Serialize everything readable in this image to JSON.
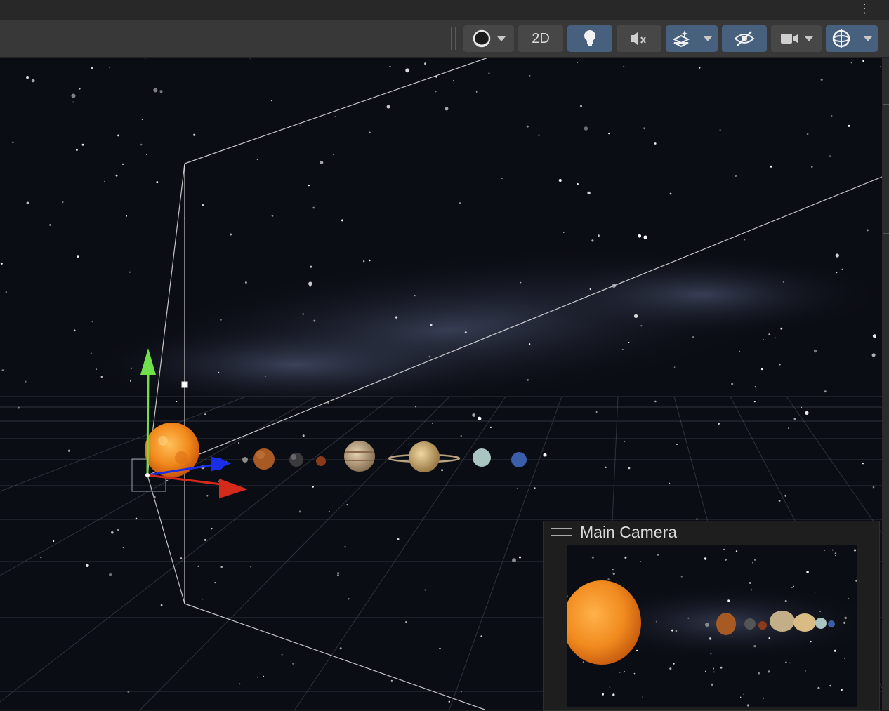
{
  "toolbar": {
    "shading_mode": {
      "icon": "shading-sphere-icon"
    },
    "mode_2d_label": "2D",
    "lighting": {
      "icon": "lightbulb-icon",
      "active": true
    },
    "audio": {
      "icon": "audio-mute-icon",
      "active": false
    },
    "effects": {
      "icon": "effects-stack-icon",
      "active": true
    },
    "hidden_objects": {
      "icon": "eye-slash-icon",
      "active": true
    },
    "camera": {
      "icon": "video-camera-icon"
    },
    "gizmos": {
      "icon": "gizmo-globe-icon",
      "active": true
    },
    "menu_icon": "more-vertical-icon"
  },
  "overlay": {
    "camera_preview_title": "Main Camera"
  },
  "scene": {
    "selected_object": "sun",
    "planets": [
      "mercury",
      "venus",
      "earth",
      "mars",
      "jupiter",
      "saturn",
      "uranus",
      "neptune"
    ]
  },
  "colors": {
    "toolbar_bg": "#383838",
    "button_bg": "#474747",
    "button_active": "#46607e",
    "gizmo_x": "#d42a1c",
    "gizmo_y": "#6fe04a",
    "gizmo_z": "#1a2ee8"
  }
}
